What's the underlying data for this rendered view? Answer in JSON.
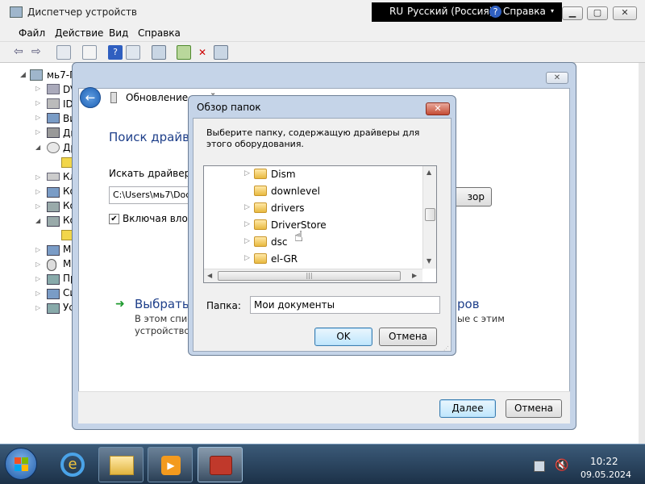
{
  "device_manager": {
    "title": "Диспетчер устройств",
    "language_bar": {
      "lang_code": "RU",
      "language": "Русский (Россия)",
      "help": "Справка"
    },
    "menu": [
      "Файл",
      "Действие",
      "Вид",
      "Справка"
    ],
    "tree": {
      "root": "мь7-П",
      "items": [
        "DV",
        "ID",
        "Ви",
        "Ди",
        "Др",
        "Кл",
        "Ко",
        "Ко",
        "Ко",
        "М",
        "М",
        "Пр",
        "Си",
        "Ус"
      ]
    }
  },
  "wizard": {
    "title": "Обновление драйверов",
    "heading": "Поиск драйве",
    "search_label": "Искать драйверы",
    "path_value": "C:\\Users\\мь7\\Doc",
    "browse_button": "зор",
    "include_subfolders": "Включая влож",
    "include_subfolders_checked": true,
    "pick_link": "Выбрать д",
    "pick_link_tail": "ров",
    "pick_desc_line1": "В этом спис",
    "pick_desc_line1_tail": "ые с этим",
    "pick_desc_line2": "устройство",
    "next_button": "Далее",
    "cancel_button": "Отмена"
  },
  "browse_dialog": {
    "title": "Обзор папок",
    "instruction": "Выберите папку, содержащую драйверы для этого оборудования.",
    "folders": [
      {
        "name": "Dism",
        "expandable": true
      },
      {
        "name": "downlevel",
        "expandable": false
      },
      {
        "name": "drivers",
        "expandable": true
      },
      {
        "name": "DriverStore",
        "expandable": true
      },
      {
        "name": "dsc",
        "expandable": true
      },
      {
        "name": "el-GR",
        "expandable": true
      }
    ],
    "folder_label": "Папка:",
    "folder_value": "Мои документы",
    "ok_button": "OK",
    "cancel_button": "Отмена"
  },
  "taskbar": {
    "time": "10:22",
    "date": "09.05.2024"
  }
}
